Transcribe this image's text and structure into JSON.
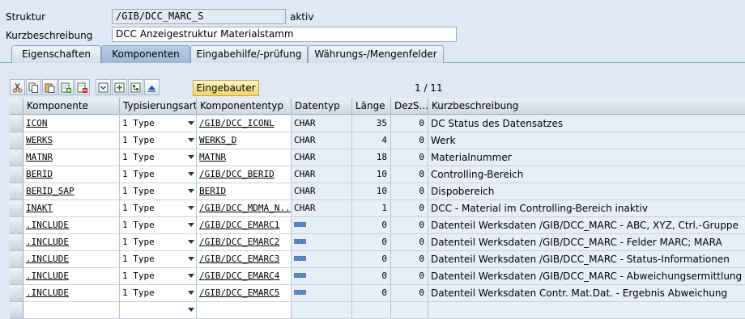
{
  "header": {
    "struktur_label": "Struktur",
    "struktur_value": "/GIB/DCC_MARC_S",
    "status": "aktiv",
    "kurz_label": "Kurzbeschreibung",
    "kurz_value": "DCC Anzeigestruktur Materialstamm"
  },
  "tabs": [
    "Eigenschaften",
    "Komponenten",
    "Eingabehilfe/-prüfung",
    "Währungs-/Mengenfelder"
  ],
  "active_tab": "Komponenten",
  "toolbar": {
    "icons": [
      "cut-icon",
      "copy-icon",
      "paste-icon",
      "insert-row-icon",
      "delete-row-icon",
      "expand-icon",
      "new-component-icon",
      "tree-icon",
      "move-up-icon"
    ],
    "type_button": "Eingebauter Typ",
    "counter": "1 / 11"
  },
  "columns": [
    "Komponente",
    "Typisierungsart",
    "Komponententyp",
    "Datentyp",
    "Länge",
    "DezS...",
    "Kurzbeschreibung"
  ],
  "rows": [
    {
      "komp": "ICON",
      "art": "1 Type",
      "typ": "/GIB/DCC_ICONL",
      "dtyp": "CHAR",
      "len": "35",
      "dez": "0",
      "desc": "DC Status des Datensatzes"
    },
    {
      "komp": "WERKS",
      "art": "1 Type",
      "typ": "WERKS_D",
      "dtyp": "CHAR",
      "len": "4",
      "dez": "0",
      "desc": "Werk"
    },
    {
      "komp": "MATNR",
      "art": "1 Type",
      "typ": "MATNR",
      "dtyp": "CHAR",
      "len": "18",
      "dez": "0",
      "desc": "Materialnummer"
    },
    {
      "komp": "BERID",
      "art": "1 Type",
      "typ": "/GIB/DCC_BERID",
      "dtyp": "CHAR",
      "len": "10",
      "dez": "0",
      "desc": "Controlling-Bereich"
    },
    {
      "komp": "BERID_SAP",
      "art": "1 Type",
      "typ": "BERID",
      "dtyp": "CHAR",
      "len": "10",
      "dez": "0",
      "desc": "Dispobereich"
    },
    {
      "komp": "INAKT",
      "art": "1 Type",
      "typ": "/GIB/DCC_MDMA_N...",
      "dtyp": "CHAR",
      "len": "1",
      "dez": "0",
      "desc": "DCC - Material im Controlling-Bereich inaktiv"
    },
    {
      "komp": ".INCLUDE",
      "art": "1 Type",
      "typ": "/GIB/DCC_EMARC1",
      "dtyp": "",
      "len": "0",
      "dez": "0",
      "desc": "Datenteil  Werksdaten /GIB/DCC_MARC - ABC, XYZ, Ctrl.-Gruppe"
    },
    {
      "komp": ".INCLUDE",
      "art": "1 Type",
      "typ": "/GIB/DCC_EMARC2",
      "dtyp": "",
      "len": "0",
      "dez": "0",
      "desc": "Datenteil  Werksdaten /GIB/DCC_MARC - Felder MARC; MARA"
    },
    {
      "komp": ".INCLUDE",
      "art": "1 Type",
      "typ": "/GIB/DCC_EMARC3",
      "dtyp": "",
      "len": "0",
      "dez": "0",
      "desc": "Datenteil  Werksdaten /GIB/DCC_MARC - Status-Informationen"
    },
    {
      "komp": ".INCLUDE",
      "art": "1 Type",
      "typ": "/GIB/DCC_EMARC4",
      "dtyp": "",
      "len": "0",
      "dez": "0",
      "desc": "Datenteil  Werksdaten /GIB/DCC_MARC -  Abweichungsermittlung"
    },
    {
      "komp": ".INCLUDE",
      "art": "1 Type",
      "typ": "/GIB/DCC_EMARC5",
      "dtyp": "",
      "len": "0",
      "dez": "0",
      "desc": "Datenteil  Werksdaten Contr. Mat.Dat. -  Ergebnis Abweichung"
    },
    {
      "komp": "",
      "art": "",
      "typ": "",
      "dtyp": "",
      "len": "",
      "dez": "",
      "desc": ""
    }
  ]
}
